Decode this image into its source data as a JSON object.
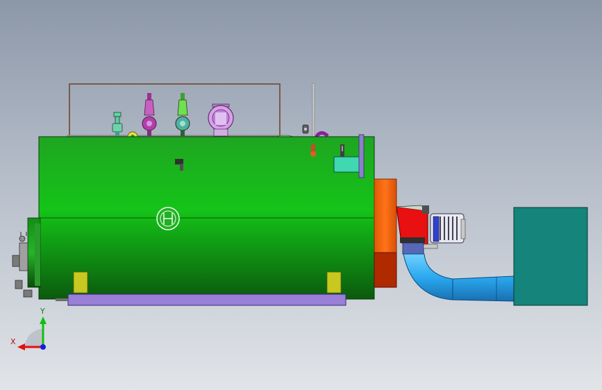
{
  "viewport": {
    "background_top": "#8c97a8",
    "background_bottom": "#e1e4e8"
  },
  "model": {
    "shell_color": "#19c21e",
    "shell_dark": "#0d5e0f",
    "base_color": "#9a7fd8",
    "door_orange": "#ff6a10",
    "door_dark": "#b02a00",
    "burner_red": "#e81010",
    "duct_blue": "#2aa8f0",
    "fan_box": "#15847a",
    "panel_cyan": "#40d8b0",
    "valve_pink": "#c060c0",
    "valve_green": "#60d040"
  },
  "triad": {
    "x_label": "X",
    "y_label": "Y",
    "x_color": "#e01010",
    "y_color": "#10c010",
    "z_color": "#1020e0"
  }
}
